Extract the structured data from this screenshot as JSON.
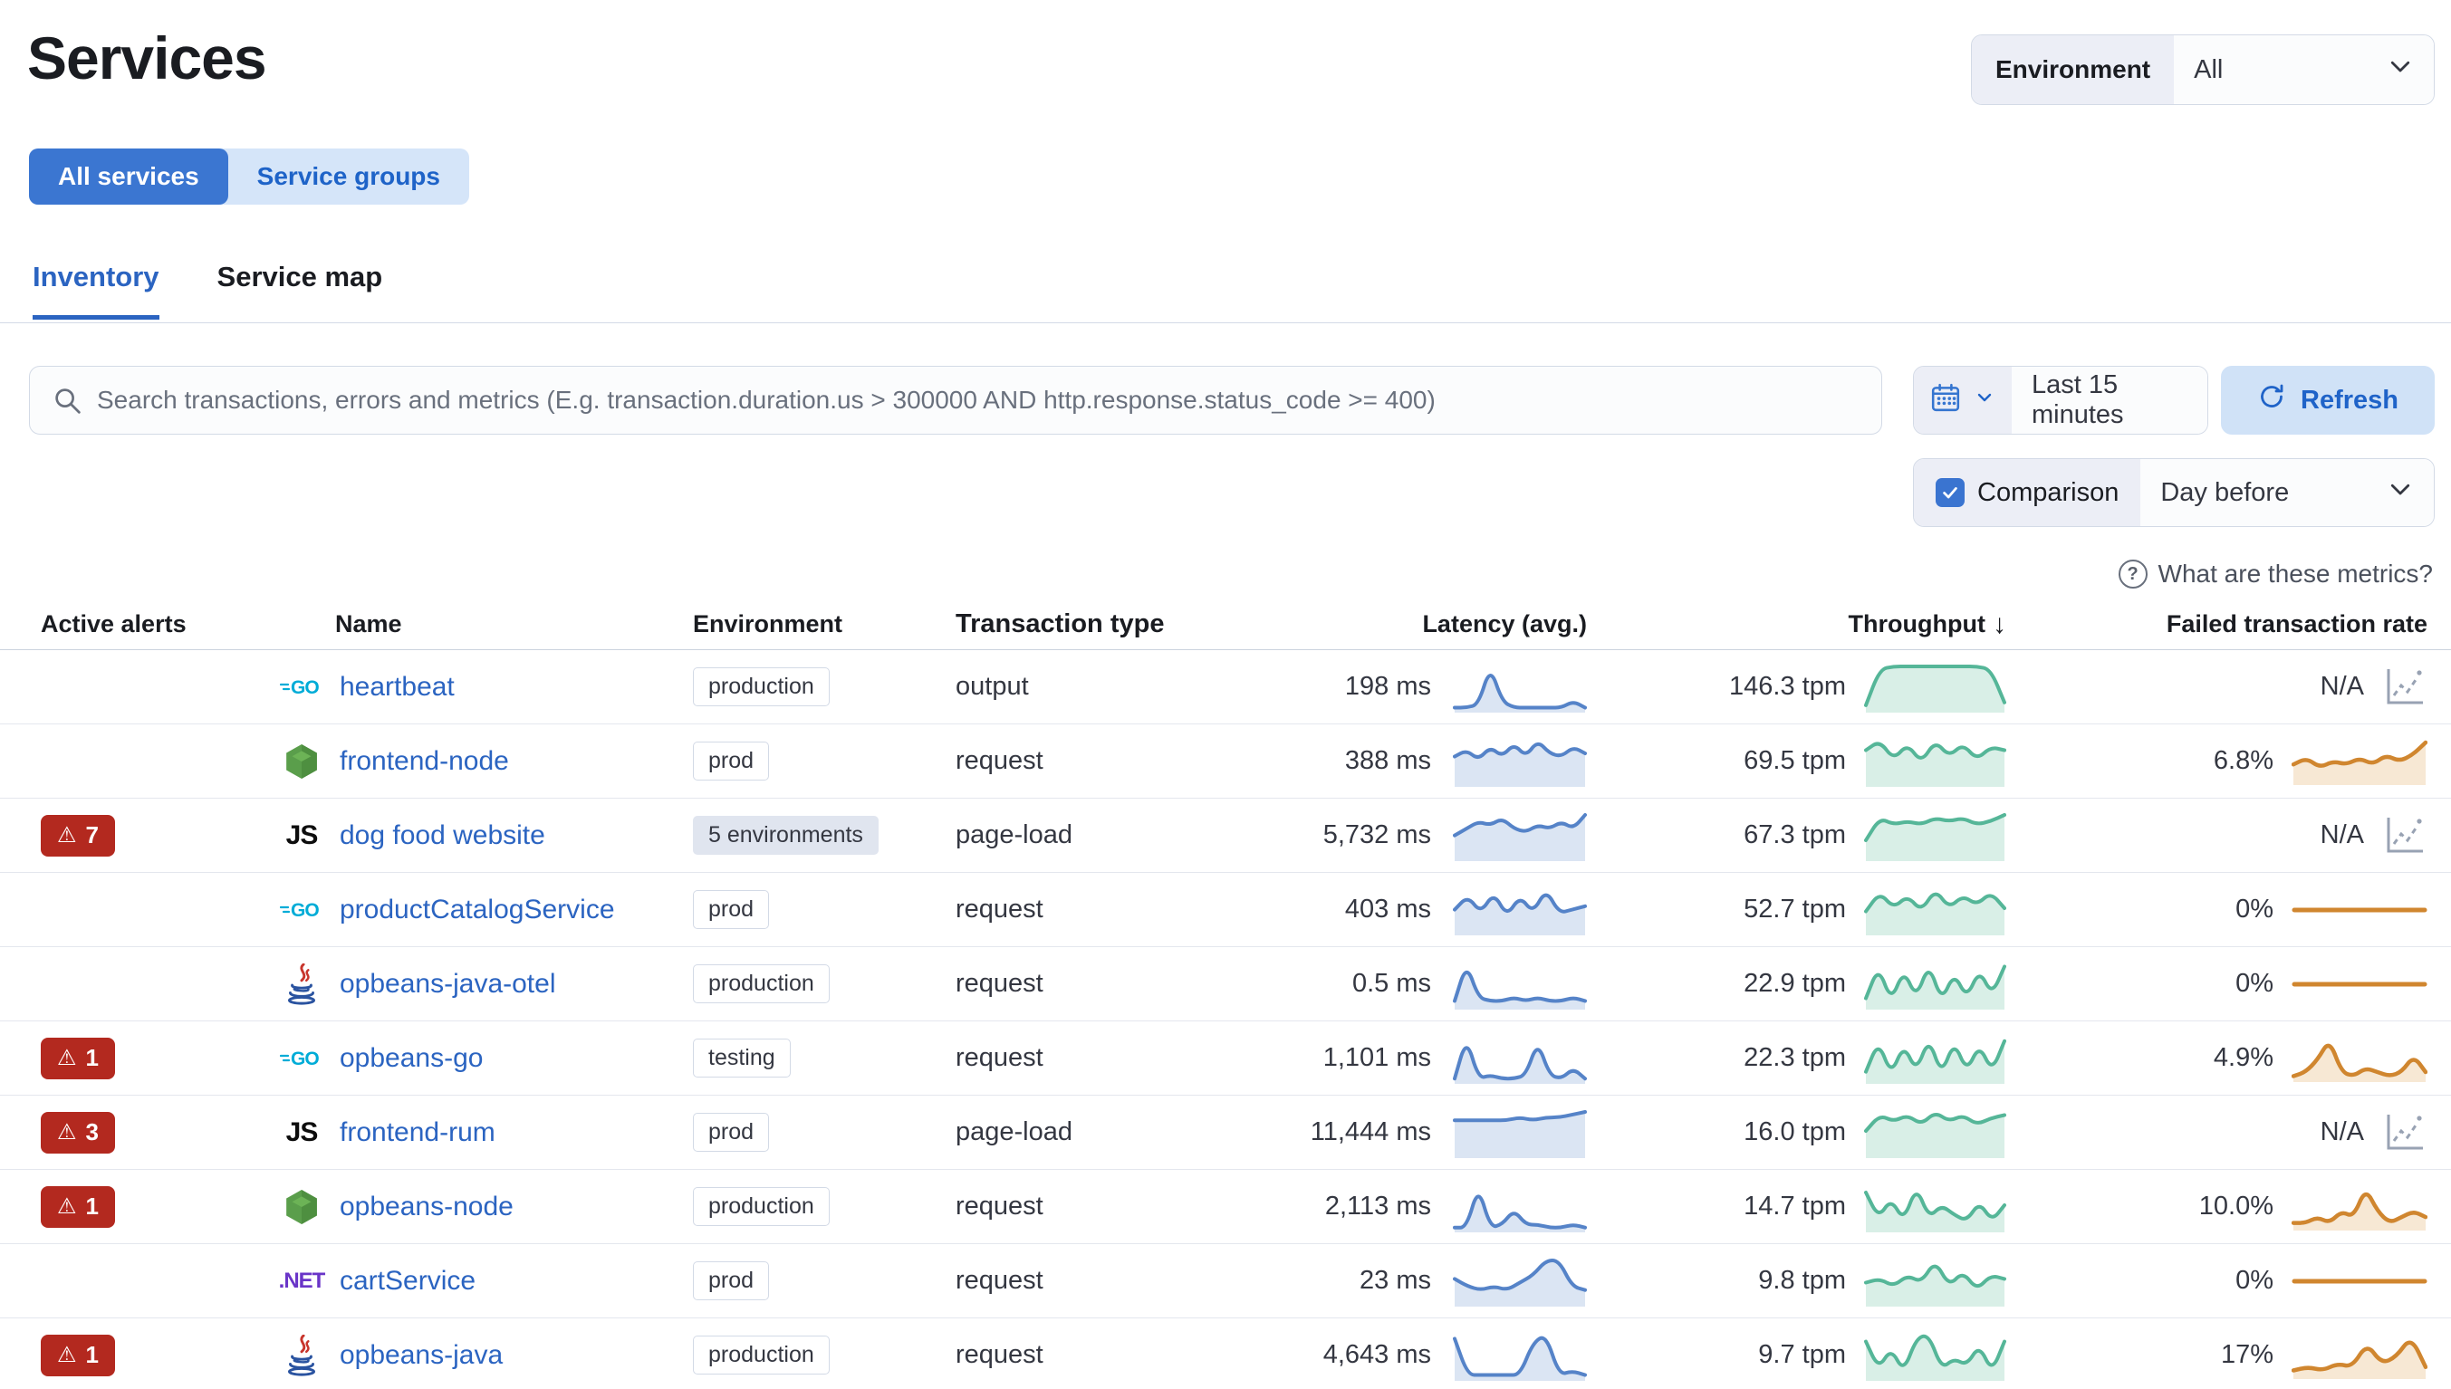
{
  "page": {
    "title": "Services"
  },
  "environment_filter": {
    "label": "Environment",
    "value": "All"
  },
  "view_toggle": {
    "options": [
      "All services",
      "Service groups"
    ],
    "selected": "All services"
  },
  "tabs": [
    {
      "label": "Inventory",
      "active": true
    },
    {
      "label": "Service map",
      "active": false
    }
  ],
  "search": {
    "placeholder": "Search transactions, errors and metrics (E.g. transaction.duration.us > 300000 AND http.response.status_code >= 400)"
  },
  "time_picker": {
    "value": "Last 15 minutes"
  },
  "refresh": {
    "label": "Refresh"
  },
  "comparison": {
    "label": "Comparison",
    "checked": true,
    "value": "Day before"
  },
  "help_link": {
    "label": "What are these metrics?"
  },
  "table": {
    "columns": {
      "alerts": "Active alerts",
      "name": "Name",
      "environment": "Environment",
      "type": "Transaction type",
      "latency": "Latency (avg.)",
      "throughput": "Throughput",
      "failed": "Failed transaction rate"
    },
    "sort": {
      "column": "Throughput",
      "direction": "desc",
      "arrow": "↓"
    },
    "rows": [
      {
        "alerts": null,
        "agent": "go",
        "name": "heartbeat",
        "environment": "production",
        "env_style": "outline",
        "type": "output",
        "latency": "198 ms",
        "throughput": "146.3 tpm",
        "failed": "N/A",
        "sparks": {
          "latency": [
            1,
            1,
            2,
            14,
            3,
            1,
            1,
            1,
            1,
            1,
            3,
            1
          ],
          "throughput": [
            2,
            15,
            16,
            16,
            16,
            16,
            16,
            16,
            16,
            15,
            3
          ],
          "failed": "na"
        }
      },
      {
        "alerts": null,
        "agent": "node",
        "name": "frontend-node",
        "environment": "prod",
        "env_style": "outline",
        "type": "request",
        "latency": "388 ms",
        "throughput": "69.5 tpm",
        "failed": "6.8%",
        "sparks": {
          "latency": [
            9,
            11,
            8,
            12,
            9,
            13,
            9,
            14,
            10,
            9,
            12,
            10
          ],
          "throughput": [
            11,
            14,
            8,
            13,
            7,
            14,
            9,
            13,
            8,
            12,
            11
          ],
          "failed": [
            6,
            8,
            5,
            7,
            6,
            8,
            6,
            9,
            7,
            9,
            13
          ]
        }
      },
      {
        "alerts": "7",
        "agent": "js",
        "name": "dog food website",
        "environment": "5 environments",
        "env_style": "filled",
        "type": "page-load",
        "latency": "5,732 ms",
        "throughput": "67.3 tpm",
        "failed": "N/A",
        "sparks": {
          "latency": [
            7,
            9,
            11,
            10,
            12,
            9,
            8,
            10,
            9,
            11,
            9,
            13
          ],
          "throughput": [
            6,
            13,
            11,
            12,
            11,
            13,
            12,
            13,
            11,
            12,
            14
          ],
          "failed": "na"
        }
      },
      {
        "alerts": null,
        "agent": "go",
        "name": "productCatalogService",
        "environment": "prod",
        "env_style": "outline",
        "type": "request",
        "latency": "403 ms",
        "throughput": "52.7 tpm",
        "failed": "0%",
        "sparks": {
          "latency": [
            7,
            11,
            6,
            12,
            5,
            11,
            6,
            13,
            6,
            7,
            8
          ],
          "throughput": [
            7,
            13,
            8,
            12,
            7,
            14,
            8,
            12,
            9,
            13,
            8
          ],
          "failed": "flat"
        }
      },
      {
        "alerts": null,
        "agent": "java",
        "name": "opbeans-java-otel",
        "environment": "production",
        "env_style": "outline",
        "type": "request",
        "latency": "0.5 ms",
        "throughput": "22.9 tpm",
        "failed": "0%",
        "sparks": {
          "latency": [
            2,
            13,
            3,
            2,
            2,
            3,
            2,
            3,
            2,
            2,
            3,
            2
          ],
          "throughput": [
            3,
            13,
            2,
            12,
            3,
            14,
            2,
            11,
            3,
            12,
            4,
            13
          ],
          "failed": "flat"
        }
      },
      {
        "alerts": "1",
        "agent": "go",
        "name": "opbeans-go",
        "environment": "testing",
        "env_style": "outline",
        "type": "request",
        "latency": "1,101 ms",
        "throughput": "22.3 tpm",
        "failed": "4.9%",
        "sparks": {
          "latency": [
            1,
            13,
            1,
            2,
            1,
            1,
            2,
            12,
            2,
            1,
            4,
            1
          ],
          "throughput": [
            3,
            12,
            2,
            11,
            3,
            13,
            2,
            12,
            3,
            11,
            3,
            12
          ],
          "failed": [
            1,
            2,
            5,
            10,
            2,
            1,
            3,
            2,
            1,
            2,
            6,
            2
          ]
        }
      },
      {
        "alerts": "3",
        "agent": "js",
        "name": "frontend-rum",
        "environment": "prod",
        "env_style": "outline",
        "type": "page-load",
        "latency": "11,444 ms",
        "throughput": "16.0 tpm",
        "failed": "N/A",
        "sparks": {
          "latency": [
            13,
            13,
            13,
            13,
            13,
            14,
            13,
            14,
            14,
            15,
            16
          ],
          "throughput": [
            8,
            13,
            11,
            13,
            10,
            14,
            11,
            13,
            10,
            12,
            13
          ],
          "failed": "na"
        }
      },
      {
        "alerts": "1",
        "agent": "node",
        "name": "opbeans-node",
        "environment": "production",
        "env_style": "outline",
        "type": "request",
        "latency": "2,113 ms",
        "throughput": "14.7 tpm",
        "failed": "10.0%",
        "sparks": {
          "latency": [
            1,
            1,
            15,
            1,
            2,
            7,
            2,
            2,
            1,
            1,
            2,
            1
          ],
          "throughput": [
            12,
            4,
            10,
            3,
            14,
            4,
            8,
            5,
            3,
            9,
            3,
            8
          ],
          "failed": [
            1,
            1,
            2,
            1,
            3,
            2,
            7,
            3,
            1,
            2,
            3,
            2
          ]
        }
      },
      {
        "alerts": null,
        "agent": "dotnet",
        "name": "cartService",
        "environment": "prod",
        "env_style": "outline",
        "type": "request",
        "latency": "23 ms",
        "throughput": "9.8 tpm",
        "failed": "0%",
        "sparks": {
          "latency": [
            7,
            5,
            4,
            5,
            4,
            6,
            8,
            12,
            12,
            5,
            4
          ],
          "throughput": [
            6,
            7,
            5,
            8,
            6,
            12,
            5,
            9,
            4,
            8,
            7
          ],
          "failed": "flat"
        }
      },
      {
        "alerts": "1",
        "agent": "java",
        "name": "opbeans-java",
        "environment": "production",
        "env_style": "outline",
        "type": "request",
        "latency": "4,643 ms",
        "throughput": "9.7 tpm",
        "failed": "17%",
        "sparks": {
          "latency": [
            10,
            1,
            1,
            1,
            1,
            1,
            9,
            11,
            1,
            2,
            1
          ],
          "throughput": [
            11,
            3,
            9,
            2,
            12,
            13,
            3,
            6,
            4,
            10,
            2,
            11
          ],
          "failed": [
            2,
            3,
            2,
            4,
            3,
            10,
            4,
            6,
            12,
            3
          ]
        }
      }
    ]
  },
  "colors": {
    "accent_blue": "#3b76d1",
    "link_blue": "#2b64c1",
    "alert_red": "#b3291f",
    "spark_green": "#55b698",
    "spark_green_fill": "#d9efe7",
    "spark_blue": "#5583c8",
    "spark_blue_fill": "#dbe5f3",
    "spark_orange": "#d0862f",
    "spark_orange_fill": "#f7e8d4",
    "na_gray": "#98a2b3"
  }
}
